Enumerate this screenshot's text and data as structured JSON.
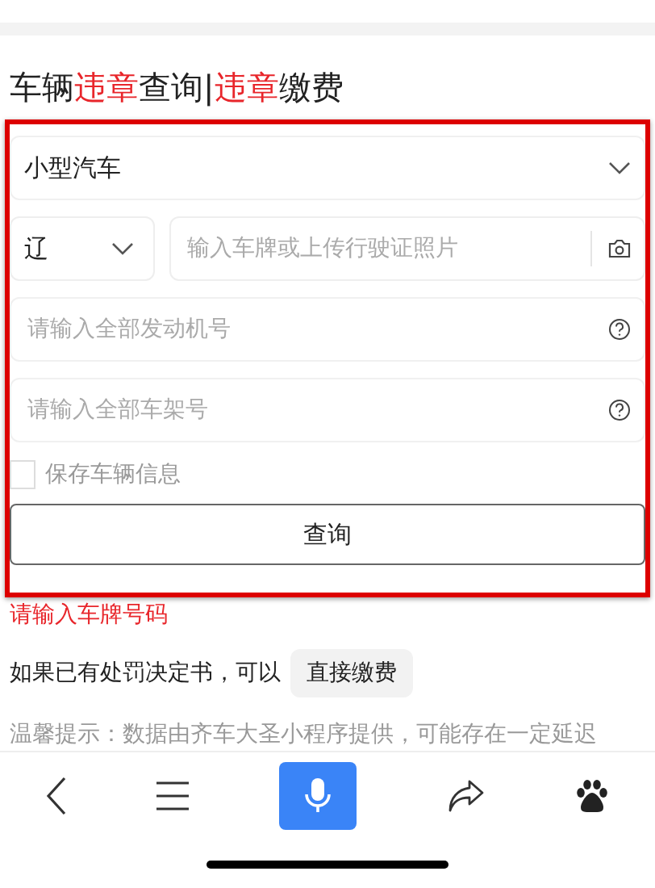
{
  "title_parts": [
    {
      "text": "车辆",
      "highlight": false
    },
    {
      "text": "违章",
      "highlight": true
    },
    {
      "text": "查询|",
      "highlight": false
    },
    {
      "text": "违章",
      "highlight": true
    },
    {
      "text": "缴费",
      "highlight": false
    }
  ],
  "form": {
    "vehicle_type": "小型汽车",
    "province": "辽",
    "plate": {
      "placeholder": "输入车牌或上传行驶证照片"
    },
    "engine": {
      "placeholder": "请输入全部发动机号"
    },
    "frame_no": {
      "placeholder": "请输入全部车架号"
    },
    "save": {
      "label": "保存车辆信息",
      "checked": false
    },
    "submit": "查询",
    "error": "请输入车牌号码"
  },
  "pay_hint": {
    "text": "如果已有处罚决定书，可以",
    "button": "直接缴费"
  },
  "tip": "温馨提示：数据由齐车大圣小程序提供，可能存在一定延迟",
  "bottom_nav": [
    {
      "kind": "back"
    },
    {
      "kind": "menu"
    },
    {
      "kind": "voice"
    },
    {
      "kind": "share"
    },
    {
      "kind": "paw"
    }
  ]
}
